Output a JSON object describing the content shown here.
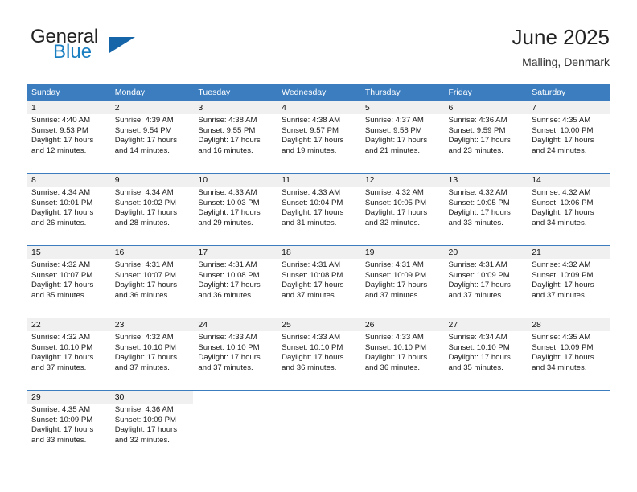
{
  "brand": {
    "name_part1": "General",
    "name_part2": "Blue",
    "logo_icon": "blue-triangle-icon"
  },
  "header": {
    "title": "June 2025",
    "subtitle": "Malling, Denmark"
  },
  "calendar": {
    "accent_color": "#3B7DBF",
    "daynum_bg_color": "#f0f0f0",
    "columns": [
      "Sunday",
      "Monday",
      "Tuesday",
      "Wednesday",
      "Thursday",
      "Friday",
      "Saturday"
    ],
    "weeks": [
      [
        {
          "day": "1",
          "sunrise": "Sunrise: 4:40 AM",
          "sunset": "Sunset: 9:53 PM",
          "daylight_line1": "Daylight: 17 hours",
          "daylight_line2": "and 12 minutes."
        },
        {
          "day": "2",
          "sunrise": "Sunrise: 4:39 AM",
          "sunset": "Sunset: 9:54 PM",
          "daylight_line1": "Daylight: 17 hours",
          "daylight_line2": "and 14 minutes."
        },
        {
          "day": "3",
          "sunrise": "Sunrise: 4:38 AM",
          "sunset": "Sunset: 9:55 PM",
          "daylight_line1": "Daylight: 17 hours",
          "daylight_line2": "and 16 minutes."
        },
        {
          "day": "4",
          "sunrise": "Sunrise: 4:38 AM",
          "sunset": "Sunset: 9:57 PM",
          "daylight_line1": "Daylight: 17 hours",
          "daylight_line2": "and 19 minutes."
        },
        {
          "day": "5",
          "sunrise": "Sunrise: 4:37 AM",
          "sunset": "Sunset: 9:58 PM",
          "daylight_line1": "Daylight: 17 hours",
          "daylight_line2": "and 21 minutes."
        },
        {
          "day": "6",
          "sunrise": "Sunrise: 4:36 AM",
          "sunset": "Sunset: 9:59 PM",
          "daylight_line1": "Daylight: 17 hours",
          "daylight_line2": "and 23 minutes."
        },
        {
          "day": "7",
          "sunrise": "Sunrise: 4:35 AM",
          "sunset": "Sunset: 10:00 PM",
          "daylight_line1": "Daylight: 17 hours",
          "daylight_line2": "and 24 minutes."
        }
      ],
      [
        {
          "day": "8",
          "sunrise": "Sunrise: 4:34 AM",
          "sunset": "Sunset: 10:01 PM",
          "daylight_line1": "Daylight: 17 hours",
          "daylight_line2": "and 26 minutes."
        },
        {
          "day": "9",
          "sunrise": "Sunrise: 4:34 AM",
          "sunset": "Sunset: 10:02 PM",
          "daylight_line1": "Daylight: 17 hours",
          "daylight_line2": "and 28 minutes."
        },
        {
          "day": "10",
          "sunrise": "Sunrise: 4:33 AM",
          "sunset": "Sunset: 10:03 PM",
          "daylight_line1": "Daylight: 17 hours",
          "daylight_line2": "and 29 minutes."
        },
        {
          "day": "11",
          "sunrise": "Sunrise: 4:33 AM",
          "sunset": "Sunset: 10:04 PM",
          "daylight_line1": "Daylight: 17 hours",
          "daylight_line2": "and 31 minutes."
        },
        {
          "day": "12",
          "sunrise": "Sunrise: 4:32 AM",
          "sunset": "Sunset: 10:05 PM",
          "daylight_line1": "Daylight: 17 hours",
          "daylight_line2": "and 32 minutes."
        },
        {
          "day": "13",
          "sunrise": "Sunrise: 4:32 AM",
          "sunset": "Sunset: 10:05 PM",
          "daylight_line1": "Daylight: 17 hours",
          "daylight_line2": "and 33 minutes."
        },
        {
          "day": "14",
          "sunrise": "Sunrise: 4:32 AM",
          "sunset": "Sunset: 10:06 PM",
          "daylight_line1": "Daylight: 17 hours",
          "daylight_line2": "and 34 minutes."
        }
      ],
      [
        {
          "day": "15",
          "sunrise": "Sunrise: 4:32 AM",
          "sunset": "Sunset: 10:07 PM",
          "daylight_line1": "Daylight: 17 hours",
          "daylight_line2": "and 35 minutes."
        },
        {
          "day": "16",
          "sunrise": "Sunrise: 4:31 AM",
          "sunset": "Sunset: 10:07 PM",
          "daylight_line1": "Daylight: 17 hours",
          "daylight_line2": "and 36 minutes."
        },
        {
          "day": "17",
          "sunrise": "Sunrise: 4:31 AM",
          "sunset": "Sunset: 10:08 PM",
          "daylight_line1": "Daylight: 17 hours",
          "daylight_line2": "and 36 minutes."
        },
        {
          "day": "18",
          "sunrise": "Sunrise: 4:31 AM",
          "sunset": "Sunset: 10:08 PM",
          "daylight_line1": "Daylight: 17 hours",
          "daylight_line2": "and 37 minutes."
        },
        {
          "day": "19",
          "sunrise": "Sunrise: 4:31 AM",
          "sunset": "Sunset: 10:09 PM",
          "daylight_line1": "Daylight: 17 hours",
          "daylight_line2": "and 37 minutes."
        },
        {
          "day": "20",
          "sunrise": "Sunrise: 4:31 AM",
          "sunset": "Sunset: 10:09 PM",
          "daylight_line1": "Daylight: 17 hours",
          "daylight_line2": "and 37 minutes."
        },
        {
          "day": "21",
          "sunrise": "Sunrise: 4:32 AM",
          "sunset": "Sunset: 10:09 PM",
          "daylight_line1": "Daylight: 17 hours",
          "daylight_line2": "and 37 minutes."
        }
      ],
      [
        {
          "day": "22",
          "sunrise": "Sunrise: 4:32 AM",
          "sunset": "Sunset: 10:10 PM",
          "daylight_line1": "Daylight: 17 hours",
          "daylight_line2": "and 37 minutes."
        },
        {
          "day": "23",
          "sunrise": "Sunrise: 4:32 AM",
          "sunset": "Sunset: 10:10 PM",
          "daylight_line1": "Daylight: 17 hours",
          "daylight_line2": "and 37 minutes."
        },
        {
          "day": "24",
          "sunrise": "Sunrise: 4:33 AM",
          "sunset": "Sunset: 10:10 PM",
          "daylight_line1": "Daylight: 17 hours",
          "daylight_line2": "and 37 minutes."
        },
        {
          "day": "25",
          "sunrise": "Sunrise: 4:33 AM",
          "sunset": "Sunset: 10:10 PM",
          "daylight_line1": "Daylight: 17 hours",
          "daylight_line2": "and 36 minutes."
        },
        {
          "day": "26",
          "sunrise": "Sunrise: 4:33 AM",
          "sunset": "Sunset: 10:10 PM",
          "daylight_line1": "Daylight: 17 hours",
          "daylight_line2": "and 36 minutes."
        },
        {
          "day": "27",
          "sunrise": "Sunrise: 4:34 AM",
          "sunset": "Sunset: 10:10 PM",
          "daylight_line1": "Daylight: 17 hours",
          "daylight_line2": "and 35 minutes."
        },
        {
          "day": "28",
          "sunrise": "Sunrise: 4:35 AM",
          "sunset": "Sunset: 10:09 PM",
          "daylight_line1": "Daylight: 17 hours",
          "daylight_line2": "and 34 minutes."
        }
      ],
      [
        {
          "day": "29",
          "sunrise": "Sunrise: 4:35 AM",
          "sunset": "Sunset: 10:09 PM",
          "daylight_line1": "Daylight: 17 hours",
          "daylight_line2": "and 33 minutes."
        },
        {
          "day": "30",
          "sunrise": "Sunrise: 4:36 AM",
          "sunset": "Sunset: 10:09 PM",
          "daylight_line1": "Daylight: 17 hours",
          "daylight_line2": "and 32 minutes."
        },
        null,
        null,
        null,
        null,
        null
      ]
    ]
  }
}
